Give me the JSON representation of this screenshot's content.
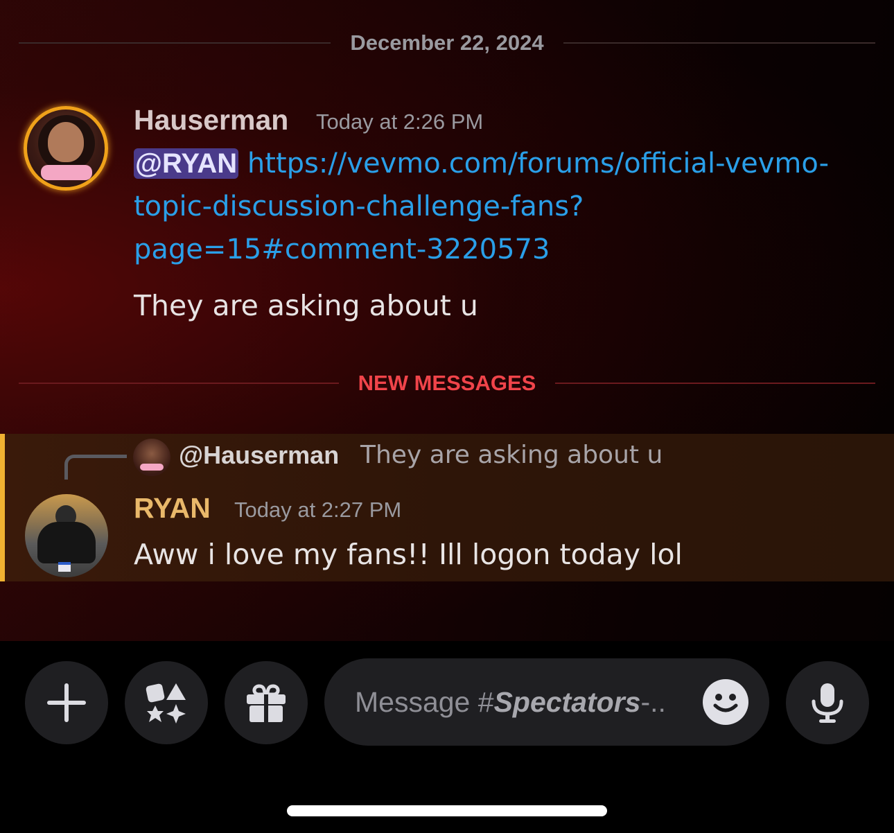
{
  "date_divider": "December 22, 2024",
  "new_messages_divider": "NEW MESSAGES",
  "messages": [
    {
      "author": "Hauserman",
      "timestamp": "Today at 2:26 PM",
      "mention": "@RYAN",
      "link_line1": "https://vevmo.com/forums/official-vevmo-",
      "link_line2": "topic-discussion-challenge-fans?",
      "link_line3": "page=15#comment-3220573",
      "text": "They are asking about u",
      "author_color": "#d8c8c8"
    },
    {
      "reply_to_author": "@Hauserman",
      "reply_to_text": "They are asking about u",
      "author": "RYAN",
      "timestamp": "Today at 2:27 PM",
      "text": "Aww i love my fans!! Ill logon today lol",
      "author_color": "#e9b86a"
    }
  ],
  "composer": {
    "placeholder_prefix": "Message #",
    "placeholder_channel": "Spectators",
    "placeholder_suffix": "-..",
    "buttons": [
      "plus-icon",
      "apps-icon",
      "gift-icon",
      "emoji-icon",
      "microphone-icon"
    ]
  },
  "colors": {
    "mention_bg": "#4a3a8a",
    "link": "#2a9fe8",
    "new_messages": "#f0444a",
    "highlight_bar": "#f0b232"
  }
}
